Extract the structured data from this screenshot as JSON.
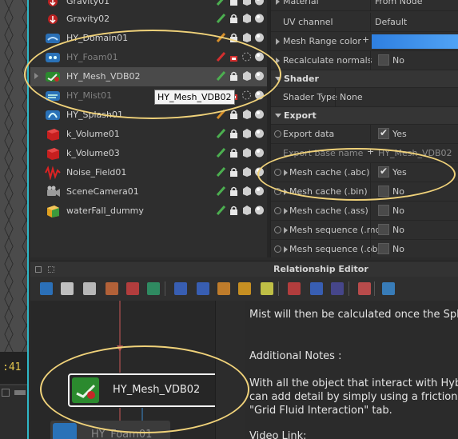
{
  "viewport": {
    "frame_label": ":41"
  },
  "outliner": {
    "rows": [
      {
        "name": "Gravity01",
        "icon": "gravity-icon",
        "dim": false,
        "selected": false,
        "expandable": false
      },
      {
        "name": "Gravity02",
        "icon": "gravity-icon",
        "dim": false,
        "selected": false,
        "expandable": false
      },
      {
        "name": "HY_Domain01",
        "icon": "hybrido-domain-icon",
        "dim": false,
        "selected": false,
        "expandable": false
      },
      {
        "name": "HY_Foam01",
        "icon": "hybrido-foam-icon",
        "dim": true,
        "selected": false,
        "expandable": false
      },
      {
        "name": "HY_Mesh_VDB02",
        "icon": "hybrido-mesh-vdb-icon",
        "dim": false,
        "selected": true,
        "expandable": true
      },
      {
        "name": "HY_Mist01",
        "icon": "hybrido-mist-icon",
        "dim": true,
        "selected": false,
        "expandable": false
      },
      {
        "name": "HY_Splash01",
        "icon": "hybrido-splash-icon",
        "dim": false,
        "selected": false,
        "expandable": false
      },
      {
        "name": "k_Volume01",
        "icon": "volume-cube-icon",
        "dim": false,
        "selected": false,
        "expandable": false
      },
      {
        "name": "k_Volume03",
        "icon": "volume-cube-icon",
        "dim": false,
        "selected": false,
        "expandable": false
      },
      {
        "name": "Noise_Field01",
        "icon": "noise-field-icon",
        "dim": false,
        "selected": false,
        "expandable": false
      },
      {
        "name": "SceneCamera01",
        "icon": "camera-icon",
        "dim": false,
        "selected": false,
        "expandable": false
      },
      {
        "name": "waterFall_dummy",
        "icon": "dummy-cube-icon",
        "dim": false,
        "selected": false,
        "expandable": false
      }
    ],
    "tooltip": "HY_Mesh_VDB02"
  },
  "properties": {
    "material": {
      "label": "Material",
      "value": "From Node"
    },
    "uv_channel": {
      "label": "UV channel",
      "value": "Default"
    },
    "mesh_range_color": {
      "label": "Mesh Range color",
      "plus": "+"
    },
    "recalc_normals": {
      "label": "Recalculate normals",
      "value": "No",
      "checked": false
    },
    "shader_section": "Shader",
    "shader_type": {
      "label": "Shader Type",
      "value": "None"
    },
    "export_section": "Export",
    "export_data": {
      "label": "Export data",
      "value": "Yes",
      "checked": true
    },
    "export_base_name": {
      "label": "Export base name",
      "plus": "+",
      "value": "HY_Mesh_VDB02"
    },
    "mesh_cache_abc": {
      "label": "Mesh cache (.abc)",
      "value": "Yes",
      "checked": true
    },
    "mesh_cache_bin": {
      "label": "Mesh cache (.bin)",
      "value": "No",
      "checked": false
    },
    "mesh_cache_ass": {
      "label": "Mesh cache (.ass)",
      "value": "No",
      "checked": false
    },
    "mesh_seq_md": {
      "label": "Mesh sequence (.md)",
      "value": "No",
      "checked": false
    },
    "mesh_seq_obj": {
      "label": "Mesh sequence (.obj)",
      "value": "No",
      "checked": false
    }
  },
  "relationship_editor": {
    "title": "Relationship Editor",
    "toolbar_icons": [
      "add-node-icon",
      "refresh-icon",
      "camera-snapshot-icon",
      "link-icon",
      "unlink-icon",
      "import-icon",
      "zoom-fit-icon",
      "zoom-selection-icon",
      "layout-icon",
      "group-icon",
      "note-icon",
      "connect-icon",
      "disconnect-icon",
      "arrange-icon",
      "frame-icon",
      "hierarchy-icon"
    ],
    "nodes": {
      "main": "HY_Mesh_VDB02",
      "secondary": "HY_Foam01"
    },
    "notes_lines": [
      "Mist will then be calculated once the Splas",
      "",
      "Additional Notes :",
      "",
      "With all the object that interact with Hybri",
      "can add detail by simply using a friction te",
      "\"Grid Fluid Interaction\" tab.",
      "",
      "Video Link:"
    ]
  },
  "colors": {
    "accent_cyan": "#2fb7c6",
    "annotation": "#f0d27a",
    "color_bar": "#3b8fea",
    "selected_row": "#4a4a4a"
  }
}
